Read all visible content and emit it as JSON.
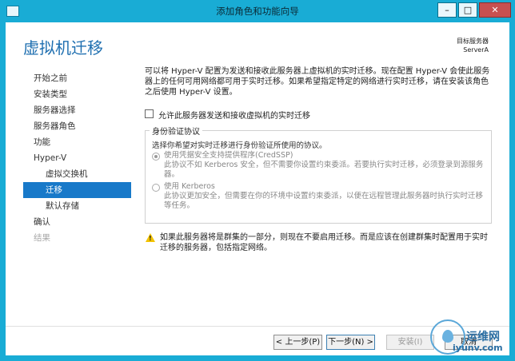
{
  "window": {
    "title": "添加角色和功能向导",
    "minimize": "–",
    "maximize": "□",
    "close": "✕"
  },
  "page": {
    "title": "虚拟机迁移",
    "target_label": "目标服务器",
    "target_server": "ServerA"
  },
  "nav": {
    "items": [
      {
        "label": "开始之前",
        "state": "normal"
      },
      {
        "label": "安装类型",
        "state": "normal"
      },
      {
        "label": "服务器选择",
        "state": "normal"
      },
      {
        "label": "服务器角色",
        "state": "normal"
      },
      {
        "label": "功能",
        "state": "normal"
      },
      {
        "label": "Hyper-V",
        "state": "normal"
      },
      {
        "label": "虚拟交换机",
        "state": "sub"
      },
      {
        "label": "迁移",
        "state": "active"
      },
      {
        "label": "默认存储",
        "state": "sub"
      },
      {
        "label": "确认",
        "state": "normal"
      },
      {
        "label": "结果",
        "state": "disabled"
      }
    ]
  },
  "content": {
    "description": "可以将 Hyper-V 配置为发送和接收此服务器上虚拟机的实时迁移。现在配置 Hyper-V 会使此服务器上的任何可用网络都可用于实时迁移。如果希望指定特定的网络进行实时迁移，请在安装该角色之后使用 Hyper-V 设置。",
    "checkbox_label": "允许此服务器发送和接收虚拟机的实时迁移",
    "checkbox_checked": false,
    "auth": {
      "legend": "身份验证协议",
      "desc": "选择你希望对实时迁移进行身份验证所使用的协议。",
      "credssp_label": "使用凭据安全支持提供程序(CredSSP)",
      "credssp_desc": "此协议不如 Kerberos 安全，但不需要你设置约束委派。若要执行实时迁移，必须登录到源服务器。",
      "kerberos_label": "使用 Kerberos",
      "kerberos_desc": "此协议更加安全，但需要在你的环境中设置约束委派，以便在远程管理此服务器时执行实时迁移等任务。",
      "selected": "credssp"
    },
    "warning": "如果此服务器将是群集的一部分，则现在不要启用迁移。而是应该在创建群集时配置用于实时迁移的服务器，包括指定网络。",
    "warning_icon": "warning-icon"
  },
  "footer": {
    "prev": "< 上一步(P)",
    "next": "下一步(N) >",
    "install": "安装(I)",
    "cancel": "取消"
  },
  "watermark": {
    "cn": "运维网",
    "en": "iyunv.com"
  }
}
